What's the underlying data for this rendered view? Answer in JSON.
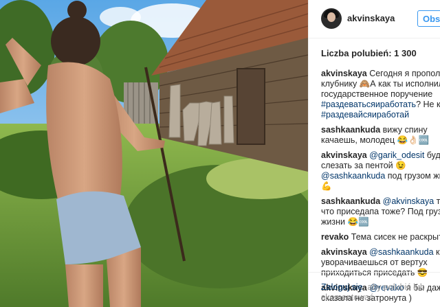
{
  "post": {
    "username": "akvinskaya",
    "follow_label": "Obserwuj",
    "likes_text": "Liczba polubień: 1 300",
    "photo_alt": "photo"
  },
  "comments": [
    {
      "user": "akvinskaya",
      "text": " Сегодня я прополола клубнику",
      "emoji": "🙈",
      "text2": "А как ты исполнил государственное поручение ",
      "tags": "#раздеватьсяиработать",
      "text3": "? Не коси, ",
      "tags2": "#раздевайсяиработай"
    },
    {
      "user": "sashkaankuda",
      "text": " вижу спину качаешь, молодец ",
      "emoji": "😂👌🏻🆒"
    },
    {
      "user": "akvinskaya",
      "mention": "@garik_odesit",
      "text": " буду слезать за пентой ",
      "emoji": "😉",
      "mention2": "@sashkaankuda",
      "text2": " под грузом жизни ",
      "emoji2": "💪"
    },
    {
      "user": "sashkaankuda",
      "mention": "@akvinskaya",
      "text": " так а что приседапа тоже? Под грузом жизни ",
      "emoji": "😂🆒"
    },
    {
      "user": "revako",
      "text": " Тема сисек не раскрыта"
    },
    {
      "user": "akvinskaya",
      "mention": "@sashkaankuda",
      "text": " когда уворачиваешься от вертух приходиться приседать ",
      "emoji": "😎"
    },
    {
      "user": "akvinskaya",
      "mention": "@revako",
      "text": " я бы даже сказала не затронута )"
    }
  ],
  "footer": {
    "login_label": "Zaloguj się",
    "rest": ", aby polubić lub skomentować."
  }
}
